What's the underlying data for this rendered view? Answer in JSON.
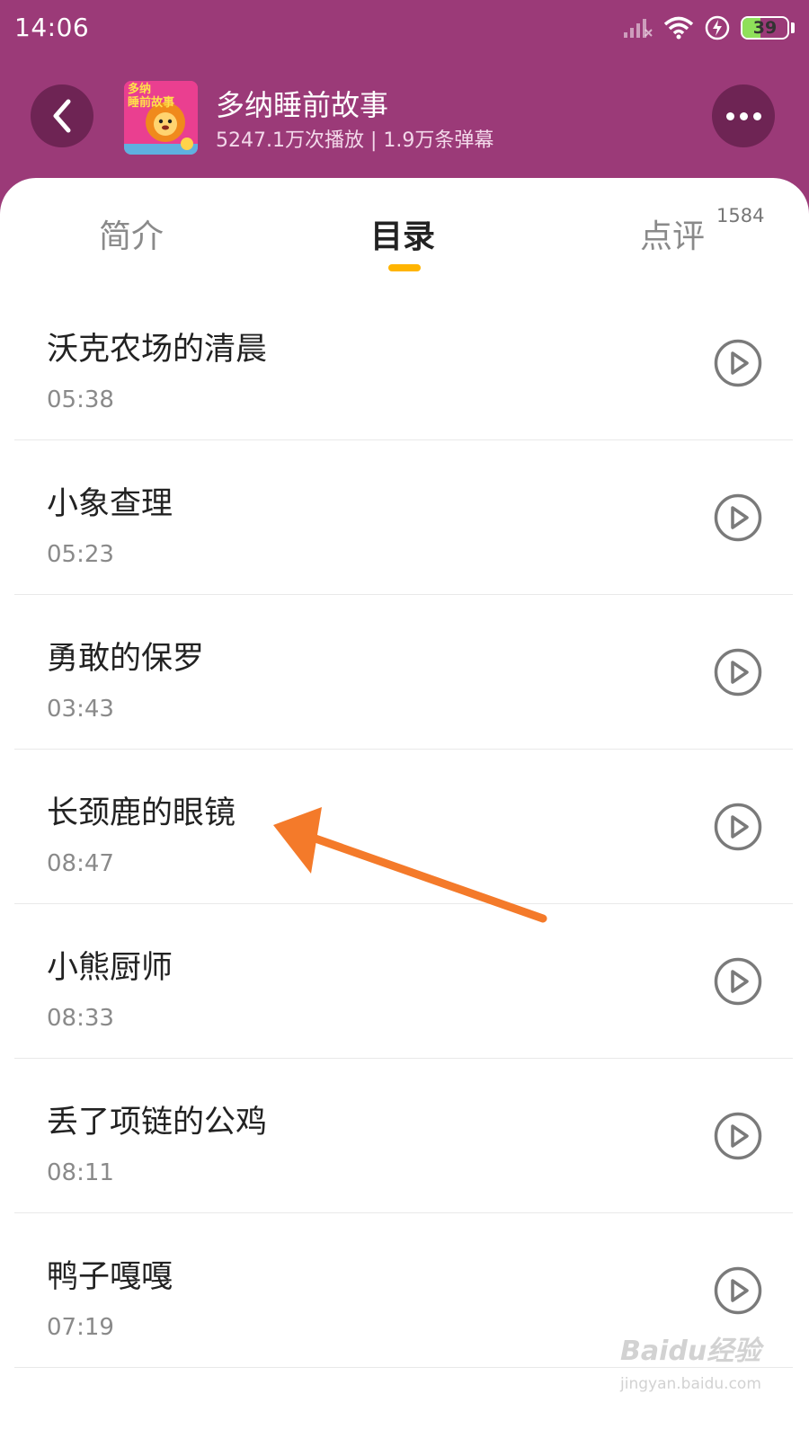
{
  "status_bar": {
    "time": "14:06",
    "battery": "39",
    "battery_level": 0.39,
    "icons": [
      "signal-icon",
      "wifi-icon",
      "charging-icon",
      "battery-icon"
    ]
  },
  "header": {
    "album_title": "多纳睡前故事",
    "album_stats": "5247.1万次播放 | 1.9万条弹幕",
    "cover_text_line1": "多纳",
    "cover_text_line2": "睡前故事"
  },
  "tabs": [
    {
      "label": "简介"
    },
    {
      "label": "目录",
      "active": true
    },
    {
      "label": "点评",
      "count": "1584"
    }
  ],
  "tracks": [
    {
      "title": "沃克农场的清晨",
      "duration": "05:38"
    },
    {
      "title": "小象查理",
      "duration": "05:23"
    },
    {
      "title": "勇敢的保罗",
      "duration": "03:43"
    },
    {
      "title": "长颈鹿的眼镜",
      "duration": "08:47"
    },
    {
      "title": "小熊厨师",
      "duration": "08:33"
    },
    {
      "title": "丢了项链的公鸡",
      "duration": "08:11"
    },
    {
      "title": "鸭子嘎嘎",
      "duration": "07:19"
    }
  ],
  "colors": {
    "header_bg": "#9b3a78",
    "header_button_bg": "#6e2454",
    "tab_indicator": "#ffb400",
    "annotation_arrow": "#f47a2a"
  },
  "watermark": {
    "logo": "Baidu经验",
    "url": "jingyan.baidu.com"
  }
}
